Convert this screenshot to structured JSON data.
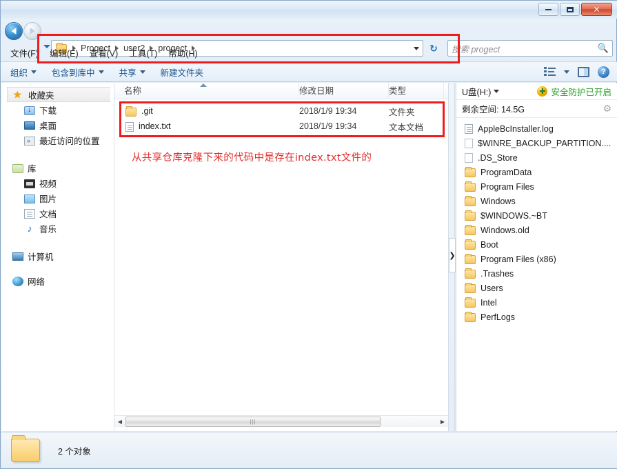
{
  "window": {
    "controls": {
      "minimize": "–",
      "maximize": "□",
      "close": "✕"
    }
  },
  "nav": {
    "back_label": "back-arrow",
    "forward_label": "forward-arrow",
    "recent_dropdown": "▾",
    "refresh_label": "↻"
  },
  "address": {
    "crumbs": [
      "Progect",
      "user2",
      "progect"
    ],
    "separator": "▶",
    "dropdown": "▾"
  },
  "search": {
    "placeholder": "搜索 progect",
    "icon": "search-icon"
  },
  "menubar": {
    "items": [
      {
        "label": "文件(F)"
      },
      {
        "label": "编辑(E)"
      },
      {
        "label": "查看(V)"
      },
      {
        "label": "工具(T)"
      },
      {
        "label": "帮助(H)"
      }
    ]
  },
  "toolbar": {
    "organize": "组织",
    "include_in_library": "包含到库中",
    "share": "共享",
    "new_folder": "新建文件夹"
  },
  "sidebar": {
    "favorites": {
      "label": "收藏夹",
      "items": [
        {
          "label": "下载",
          "icon": "download-icon"
        },
        {
          "label": "桌面",
          "icon": "desktop-icon"
        },
        {
          "label": "最近访问的位置",
          "icon": "recent-places-icon"
        }
      ]
    },
    "libraries": {
      "label": "库",
      "items": [
        {
          "label": "视频",
          "icon": "video-icon"
        },
        {
          "label": "图片",
          "icon": "picture-icon"
        },
        {
          "label": "文档",
          "icon": "document-icon"
        },
        {
          "label": "音乐",
          "icon": "music-icon"
        }
      ]
    },
    "computer": {
      "label": "计算机",
      "icon": "computer-icon"
    },
    "network": {
      "label": "网络",
      "icon": "network-icon"
    }
  },
  "filelist": {
    "columns": [
      "名称",
      "修改日期",
      "类型"
    ],
    "rows": [
      {
        "name": ".git",
        "date": "2018/1/9 19:34",
        "type": "文件夹",
        "icon": "folder-icon"
      },
      {
        "name": "index.txt",
        "date": "2018/1/9 19:34",
        "type": "文本文档",
        "icon": "text-file-icon"
      }
    ],
    "annotation": "从共享仓库克隆下来的代码中是存在index.txt文件的",
    "annotation_color": "#e32b2b",
    "highlight_color": "#ee1c1c"
  },
  "usb_panel": {
    "title": "U盘(H:)",
    "protection_status": "安全防护已开启",
    "protection_color": "#2ea32e",
    "free_space": "剩余空间: 14.5G",
    "items": [
      {
        "label": "AppleBcInstaller.log",
        "icon": "log-file-icon"
      },
      {
        "label": "$WINRE_BACKUP_PARTITION....",
        "icon": "file-icon"
      },
      {
        "label": ".DS_Store",
        "icon": "file-icon"
      },
      {
        "label": "ProgramData",
        "icon": "folder-icon"
      },
      {
        "label": "Program Files",
        "icon": "folder-icon"
      },
      {
        "label": "Windows",
        "icon": "folder-icon"
      },
      {
        "label": "$WINDOWS.~BT",
        "icon": "folder-icon"
      },
      {
        "label": "Windows.old",
        "icon": "folder-icon"
      },
      {
        "label": "Boot",
        "icon": "folder-icon"
      },
      {
        "label": "Program Files (x86)",
        "icon": "folder-icon"
      },
      {
        "label": ".Trashes",
        "icon": "folder-icon"
      },
      {
        "label": "Users",
        "icon": "folder-icon"
      },
      {
        "label": "Intel",
        "icon": "folder-icon"
      },
      {
        "label": "PerfLogs",
        "icon": "folder-icon"
      }
    ]
  },
  "statusbar": {
    "item_count": "2 个对象"
  },
  "splitter": {
    "chevron": "❯"
  }
}
